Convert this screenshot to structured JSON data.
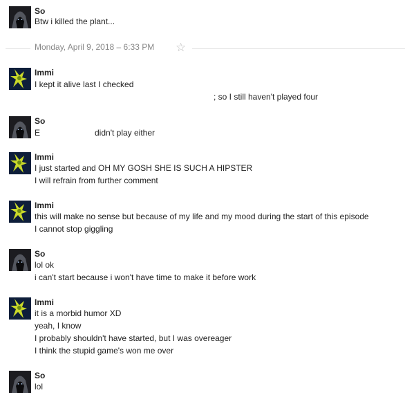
{
  "divider": {
    "date_text": "Monday, April 9, 2018  – 6:33 PM",
    "star_icon": "star-icon"
  },
  "messages": [
    {
      "sender": "So",
      "avatar": "hooded-figure-avatar",
      "lines": [
        "Btw i killed the plant..."
      ]
    },
    {
      "sender": "Immi",
      "avatar": "green-creature-avatar",
      "lines": [
        "I kept it alive last I checked",
        "; so I still haven't played four"
      ]
    },
    {
      "sender": "So",
      "avatar": "hooded-figure-avatar",
      "lines": [
        "E",
        "didn't play either"
      ]
    },
    {
      "sender": "Immi",
      "avatar": "green-creature-avatar",
      "lines": [
        "I just started and OH MY GOSH SHE IS SUCH A HIPSTER",
        "I will refrain from further comment"
      ]
    },
    {
      "sender": "Immi",
      "avatar": "green-creature-avatar",
      "lines": [
        "this will make no sense but because of my life and my mood during the start of this episode",
        "I cannot stop giggling"
      ]
    },
    {
      "sender": "So",
      "avatar": "hooded-figure-avatar",
      "lines": [
        "lol ok",
        "i can't start because i won't have time to make it before work"
      ]
    },
    {
      "sender": "Immi",
      "avatar": "green-creature-avatar",
      "lines": [
        "it is a morbid humor XD",
        "yeah, I know",
        "I probably shouldn't have started, but I was overeager",
        "I think the stupid game's won me over"
      ]
    },
    {
      "sender": "So",
      "avatar": "hooded-figure-avatar",
      "lines": [
        "lol"
      ]
    }
  ]
}
